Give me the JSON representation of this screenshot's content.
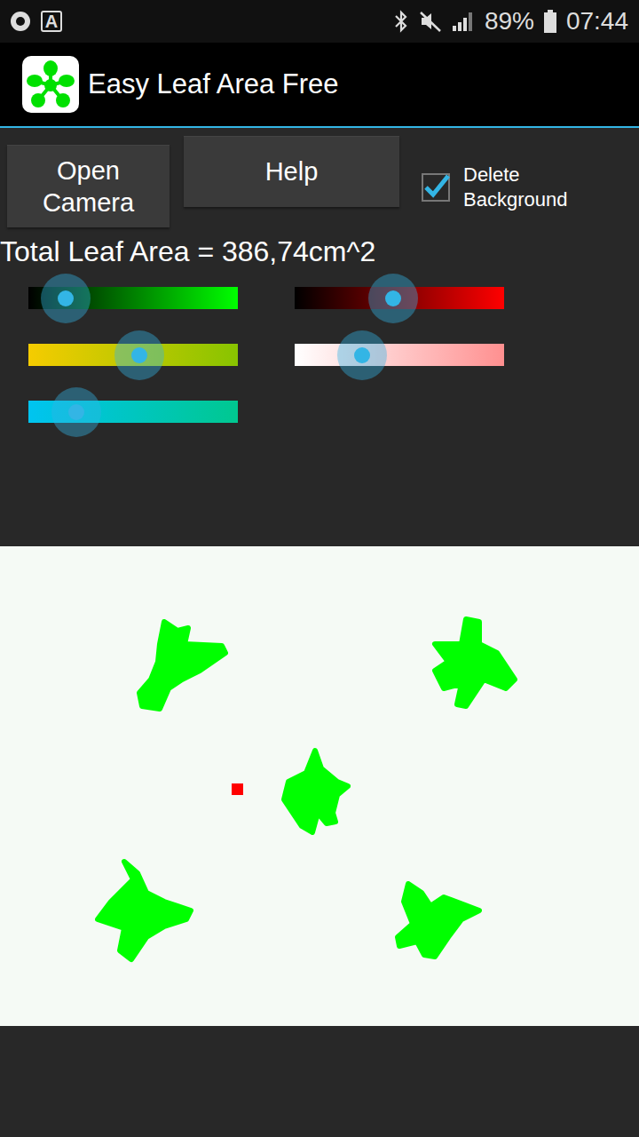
{
  "status_bar": {
    "notification_glyph": "A",
    "battery": "89%",
    "time": "07:44"
  },
  "app_bar": {
    "title": "Easy Leaf Area Free"
  },
  "buttons": [
    "Open Camera",
    "Help"
  ],
  "checkbox": {
    "label": "Delete Background",
    "checked": true
  },
  "total": "Total Leaf Area = 386,74cm^2",
  "sliders": [
    {
      "name": "green",
      "column": 0,
      "level": 0.18,
      "start_color": "#000000",
      "color": "#00ff00"
    },
    {
      "name": "yellow",
      "column": 0,
      "level": 0.53,
      "start_color": "#f5cc00",
      "color": "#88c400"
    },
    {
      "name": "cyan",
      "column": 0,
      "level": 0.23,
      "start_color": "#00c4f0",
      "color": "#00c890"
    },
    {
      "name": "red",
      "column": 1,
      "level": 0.47,
      "start_color": "#000000",
      "color": "#ff0000"
    },
    {
      "name": "pink",
      "column": 1,
      "level": 0.32,
      "start_color": "#ffffff",
      "color": "#ff9090"
    }
  ]
}
